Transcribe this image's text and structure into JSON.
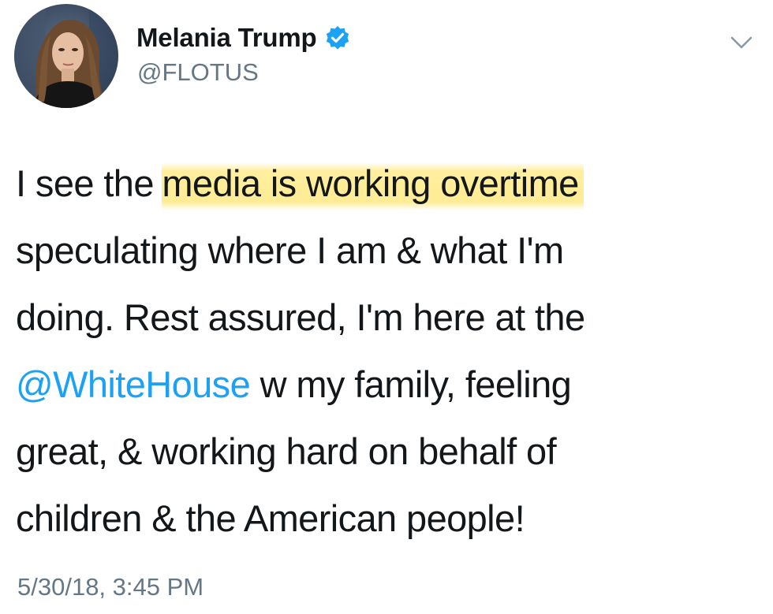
{
  "user": {
    "display_name": "Melania Trump",
    "handle": "@FLOTUS",
    "verified": true,
    "avatar_icon": "profile-photo"
  },
  "tweet": {
    "line1_pre": "I see the ",
    "line1_highlight": "media is working overtime",
    "line2": "speculating where I am & what I'm",
    "line3": "doing.  Rest assured, I'm here at the",
    "line4_mention": "@WhiteHouse",
    "line4_post": " w my family, feeling",
    "line5": "great, & working hard on behalf of",
    "line6": "children & the American people!",
    "timestamp": "5/30/18, 3:45 PM"
  },
  "icons": {
    "verified": "verified-badge-icon",
    "menu": "chevron-down-icon"
  },
  "colors": {
    "link": "#1da1f2",
    "muted": "#657786",
    "text": "#14171a",
    "highlight": "#ffec8c"
  }
}
